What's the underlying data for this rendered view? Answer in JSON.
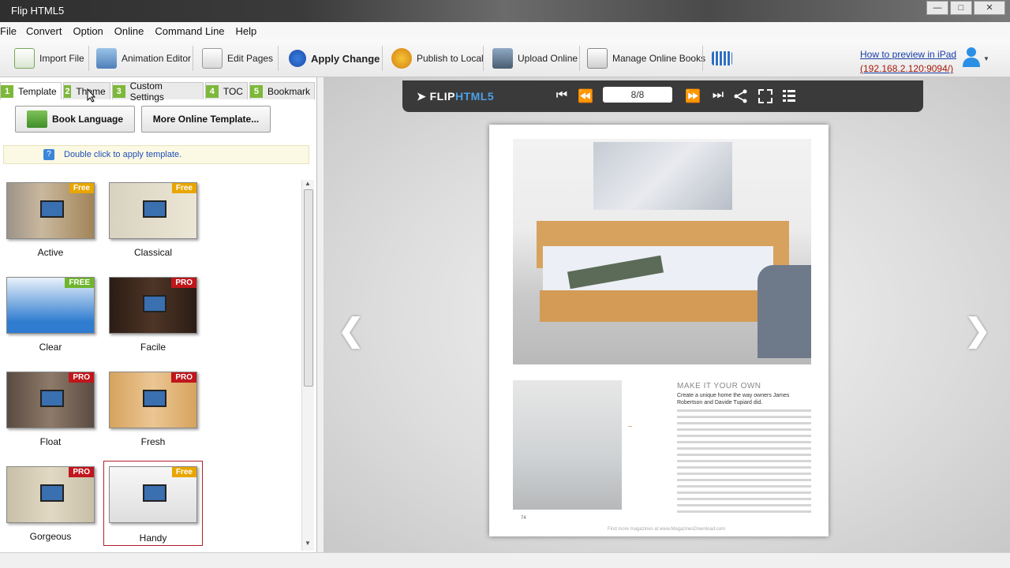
{
  "window": {
    "title": "Flip HTML5"
  },
  "menu": [
    "File",
    "Convert",
    "Option",
    "Online",
    "Command Line",
    "Help"
  ],
  "toolbar": {
    "import": "Import File",
    "animation": "Animation Editor",
    "edit": "Edit Pages",
    "apply": "Apply Change",
    "publish": "Publish to Local",
    "upload": "Upload Online",
    "manage": "Manage Online Books"
  },
  "preview": {
    "line1": "How to preview in iPad",
    "line2": "(192.168.2.120:9094/)"
  },
  "tabs": [
    {
      "num": "1",
      "label": "Template"
    },
    {
      "num": "2",
      "label": "Theme"
    },
    {
      "num": "3",
      "label": "Custom Settings"
    },
    {
      "num": "4",
      "label": "TOC"
    },
    {
      "num": "5",
      "label": "Bookmark"
    }
  ],
  "buttons": {
    "language": "Book Language",
    "more": "More Online Template..."
  },
  "hint": "Double click to apply template.",
  "templates": [
    {
      "name": "Active",
      "badge": "Free"
    },
    {
      "name": "Classical",
      "badge": "Free"
    },
    {
      "name": "Clear",
      "badge": "FREE"
    },
    {
      "name": "Facile",
      "badge": "PRO"
    },
    {
      "name": "Float",
      "badge": "PRO"
    },
    {
      "name": "Fresh",
      "badge": "PRO"
    },
    {
      "name": "Gorgeous",
      "badge": "PRO"
    },
    {
      "name": "Handy",
      "badge": "Free"
    }
  ],
  "viewer": {
    "logo_a": "FLIP",
    "logo_b": "HTML5",
    "page": "8/8"
  },
  "magazine": {
    "heading": "MAKE IT YOUR OWN",
    "subheading": "Create a unique home the way owners James Robertson and Davide Tupiard did.",
    "folio": "74",
    "source": "Find more magazines at www.MagazinesDownload.com"
  }
}
